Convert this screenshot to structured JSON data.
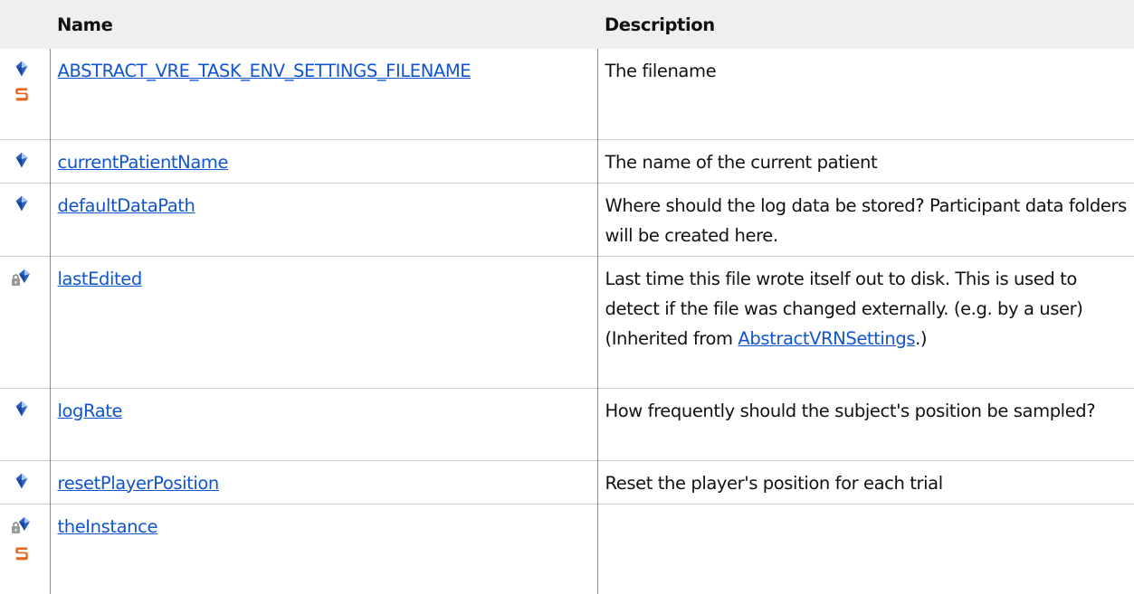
{
  "table": {
    "headers": {
      "icon": "",
      "name": "Name",
      "description": "Description"
    },
    "rows": [
      {
        "name": "ABSTRACT_VRE_TASK_ENV_SETTINGS_FILENAME",
        "description": "The filename",
        "icons": [
          "public-field-icon",
          "static-icon"
        ]
      },
      {
        "name": "currentPatientName",
        "description": "The name of the current patient",
        "icons": [
          "public-field-icon"
        ]
      },
      {
        "name": "defaultDataPath",
        "description": "Where should the log data be stored? Participant data folders will be created here.",
        "icons": [
          "public-field-icon"
        ]
      },
      {
        "name": "lastEdited",
        "description_before": "Last time this file wrote itself out to disk. This is used to detect if the file was changed externally. (e.g. by a user) (Inherited from ",
        "description_link": "AbstractVRNSettings",
        "description_after": ".)",
        "icons": [
          "protected-field-icon"
        ]
      },
      {
        "name": "logRate",
        "description": "How frequently should the subject's position be sampled?",
        "icons": [
          "public-field-icon"
        ]
      },
      {
        "name": "resetPlayerPosition",
        "description": "Reset the player's position for each trial",
        "icons": [
          "public-field-icon"
        ]
      },
      {
        "name": "theInstance",
        "description": "",
        "icons": [
          "protected-field-icon",
          "static-icon"
        ]
      }
    ]
  },
  "colors": {
    "link": "#1155cc",
    "header_background": "#efefef",
    "field_icon": "#2a5fc4",
    "static_icon": "#e8641a"
  }
}
